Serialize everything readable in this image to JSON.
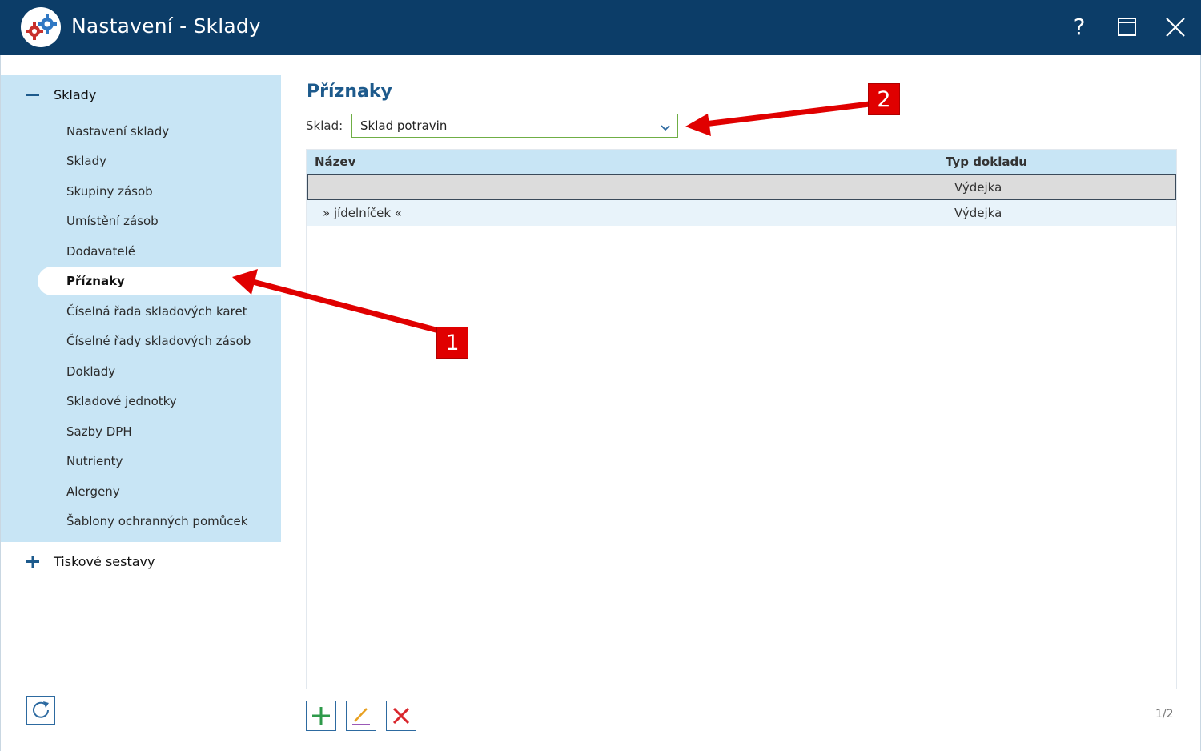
{
  "window": {
    "title": "Nastavení - Sklady",
    "controls": {
      "help": "?",
      "maximize_icon": "maximize-icon",
      "close_icon": "close-icon"
    },
    "accent": "#0c3d68"
  },
  "sidebar": {
    "groups": [
      {
        "label": "Sklady",
        "expanded": true,
        "icon": "minus-icon",
        "items": [
          {
            "label": "Nastavení sklady"
          },
          {
            "label": "Sklady"
          },
          {
            "label": "Skupiny zásob"
          },
          {
            "label": "Umístění zásob"
          },
          {
            "label": "Dodavatelé"
          },
          {
            "label": "Příznaky",
            "active": true
          },
          {
            "label": "Číselná řada skladových karet"
          },
          {
            "label": "Číselné řady skladových zásob"
          },
          {
            "label": "Doklady"
          },
          {
            "label": "Skladové jednotky"
          },
          {
            "label": "Sazby DPH"
          },
          {
            "label": "Nutrienty"
          },
          {
            "label": "Alergeny"
          },
          {
            "label": "Šablony ochranných pomůcek"
          }
        ]
      },
      {
        "label": "Tiskové sestavy",
        "expanded": false,
        "icon": "plus-icon"
      }
    ],
    "refresh_icon": "refresh-icon",
    "highlight_color": "#c8e5f5"
  },
  "main": {
    "heading": "Příznaky",
    "filter": {
      "label": "Sklad:",
      "value": "Sklad potravin"
    },
    "table": {
      "columns": [
        "Název",
        "Typ dokladu"
      ],
      "rows": [
        {
          "name": "",
          "type": "Výdejka",
          "selected": true
        },
        {
          "name": "» jídelníček «",
          "type": "Výdejka"
        }
      ]
    },
    "buttons": {
      "add_icon": "plus-icon",
      "edit_icon": "pencil-icon",
      "delete_icon": "delete-icon"
    },
    "pager": "1/2"
  },
  "annotations": [
    {
      "number": "1",
      "target": "sidebar-item-priznaky"
    },
    {
      "number": "2",
      "target": "sklad-select"
    }
  ]
}
